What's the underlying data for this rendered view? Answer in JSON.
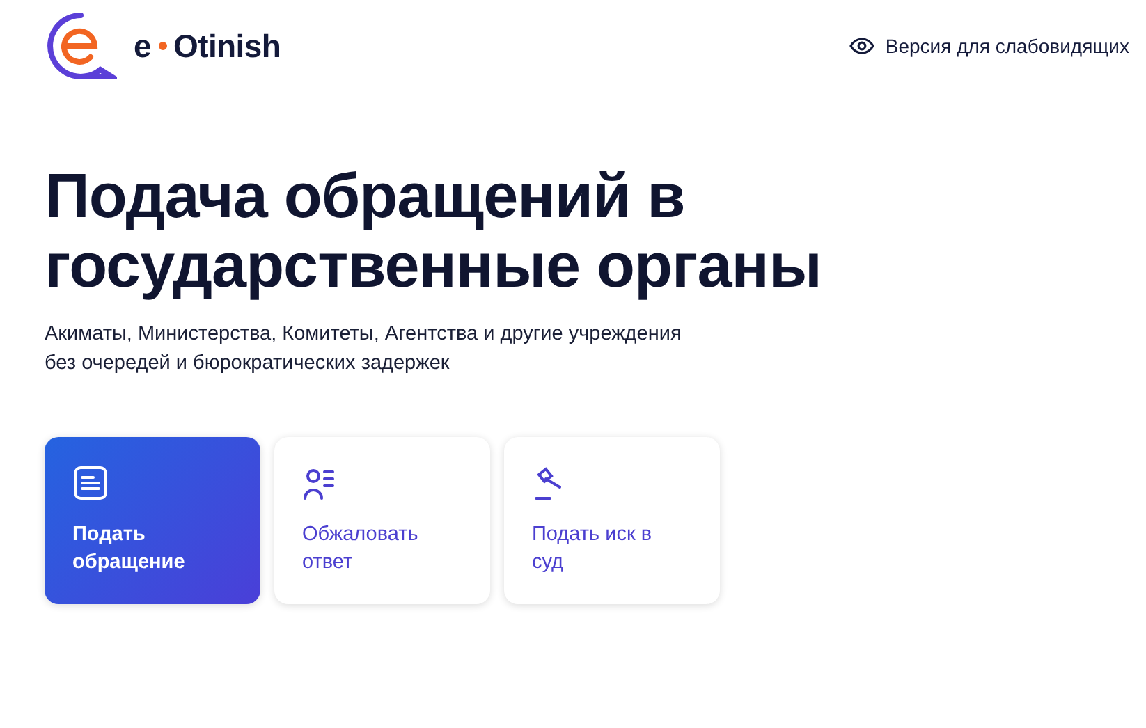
{
  "header": {
    "logo": {
      "prefix": "e",
      "name": "Otinish"
    },
    "accessibility_link": "Версия для слабовидящих"
  },
  "hero": {
    "title": "Подача обращений в государственные органы",
    "subtitle_lines": [
      "Акиматы, Министерства, Комитеты, Агентства и другие учреждения",
      "без очередей и бюрократических задержек"
    ]
  },
  "actions": [
    {
      "kind": "form",
      "label": "Подать обращение",
      "selected": true
    },
    {
      "kind": "appeal",
      "label": "Обжаловать ответ",
      "selected": false
    },
    {
      "kind": "court",
      "label": "Подать иск в суд",
      "selected": false
    }
  ]
}
